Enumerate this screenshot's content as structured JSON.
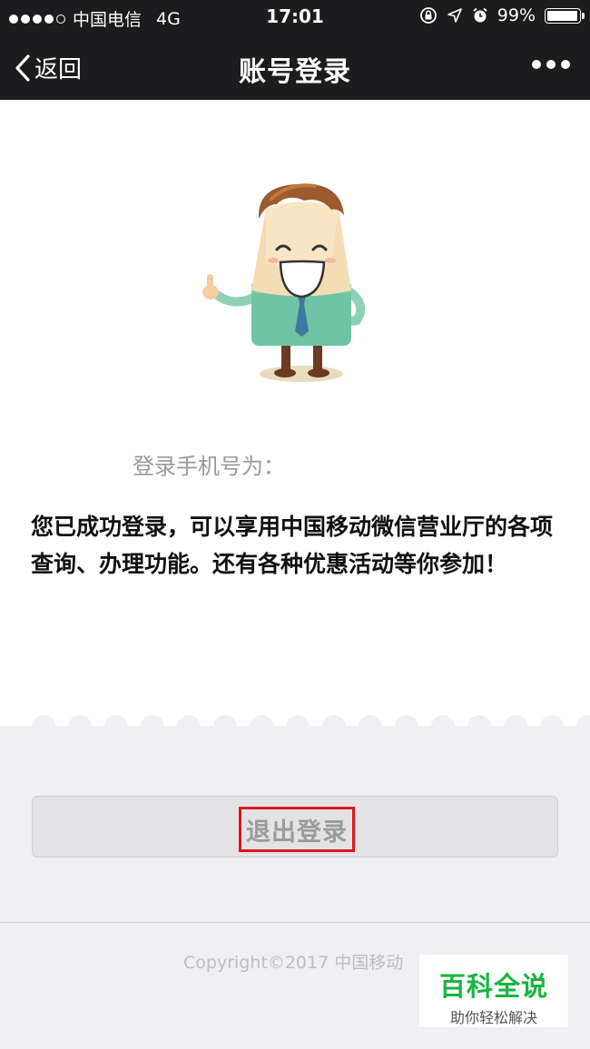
{
  "status_bar": {
    "carrier": "中国电信",
    "network": "4G",
    "time": "17:01",
    "battery_text": "99%",
    "battery_level": 0.99,
    "signal_bars_filled": 4,
    "signal_bars_total": 5
  },
  "nav": {
    "back_label": "返回",
    "title": "账号登录"
  },
  "content": {
    "phone_label": "登录手机号为：",
    "message": "您已成功登录，可以享用中国移动微信营业厅的各项查询、办理功能。还有各种优惠活动等你参加！"
  },
  "actions": {
    "logout_label": "退出登录"
  },
  "footer": {
    "copyright": "Copyright©2017 中国移动"
  },
  "watermark": {
    "title": "百科全说",
    "subtitle": "助你轻松解决"
  },
  "colors": {
    "navbar_bg": "#1c1c1e",
    "highlight_box": "#d9171d",
    "watermark_green": "#18b541",
    "lower_bg": "#efeff4"
  }
}
